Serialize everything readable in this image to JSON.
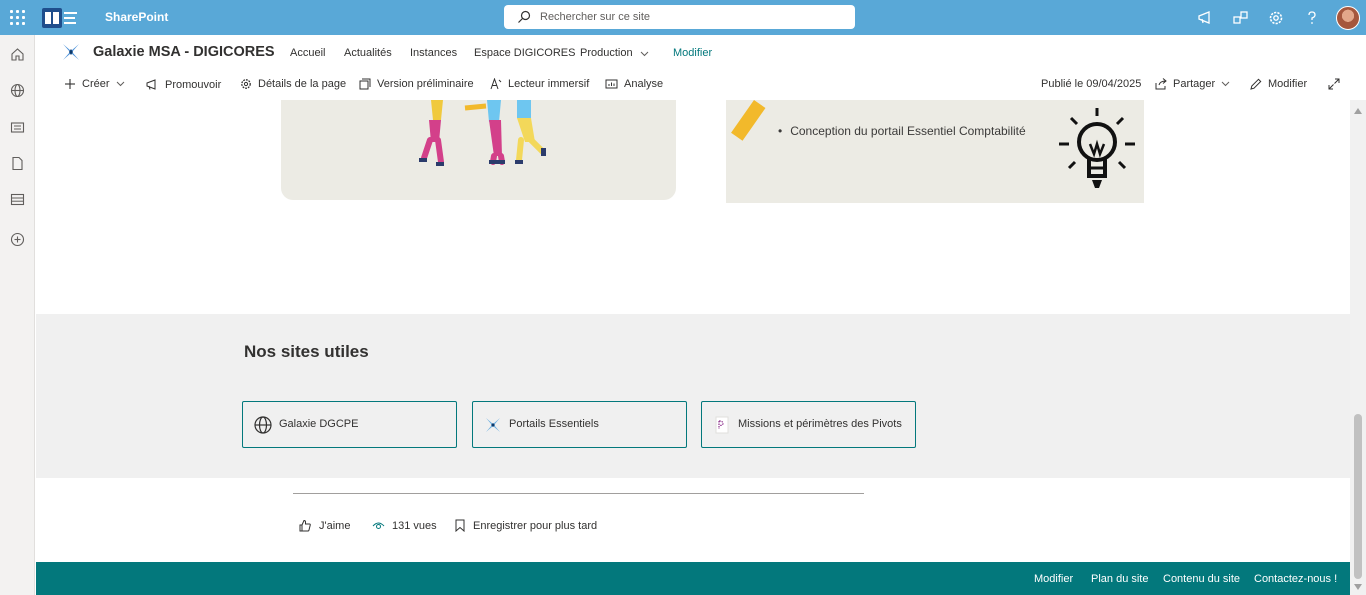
{
  "suite": {
    "app_name": "SharePoint",
    "search_placeholder": "Rechercher sur ce site",
    "colors": {
      "suite_bar": "#59a8d7",
      "theme": "#03787c"
    }
  },
  "site": {
    "title": "Galaxie MSA - DIGICORES",
    "nav": [
      {
        "label": "Accueil"
      },
      {
        "label": "Actualités"
      },
      {
        "label": "Instances"
      },
      {
        "label": "Espace DIGICORES"
      },
      {
        "label": "Production"
      },
      {
        "label": "Modifier"
      }
    ]
  },
  "commandbar": {
    "create": "Créer",
    "promote": "Promouvoir",
    "page_details": "Détails de la page",
    "preview": "Version préliminaire",
    "immersive": "Lecteur immersif",
    "analytics": "Analyse",
    "published": "Publié le 09/04/2025",
    "share": "Partager",
    "edit": "Modifier"
  },
  "content": {
    "bullet_text": "Conception du portail Essentiel Comptabilité"
  },
  "useful_sites": {
    "title": "Nos sites utiles",
    "links": [
      {
        "label": "Galaxie DGCPE",
        "icon": "globe-icon"
      },
      {
        "label": "Portails Essentiels",
        "icon": "star-logo-icon"
      },
      {
        "label": "Missions et périmètres des Pivots",
        "icon": "document-icon"
      }
    ]
  },
  "social": {
    "like": "J'aime",
    "views": "131 vues",
    "save": "Enregistrer pour plus tard"
  },
  "footer": {
    "links": [
      "Modifier",
      "Plan du site",
      "Contenu du site",
      "Contactez-nous !"
    ]
  }
}
